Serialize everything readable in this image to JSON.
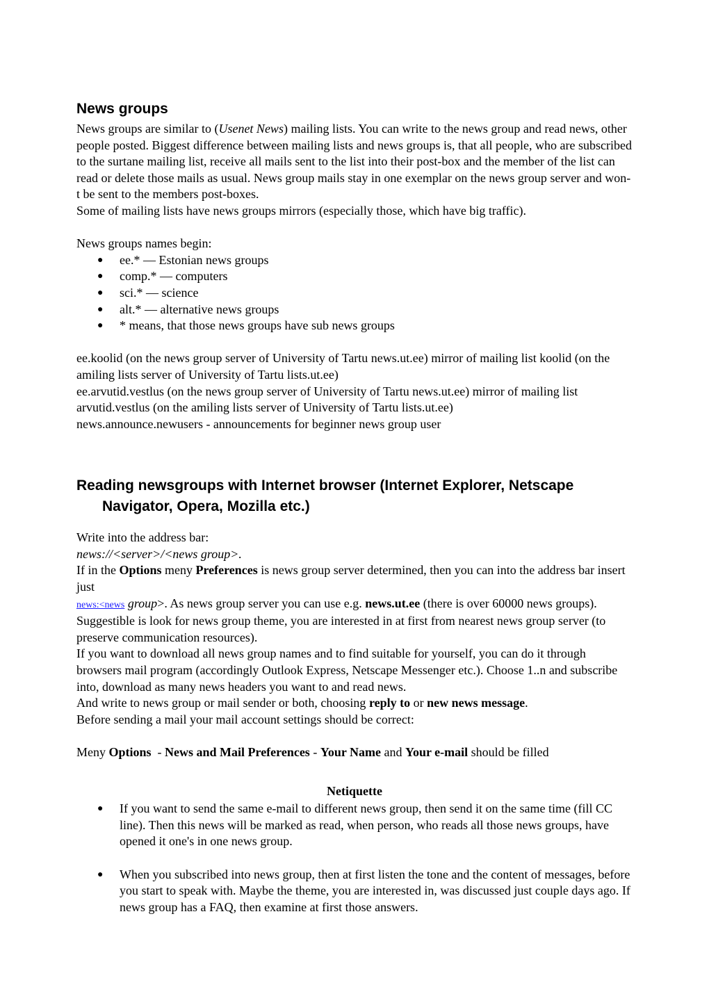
{
  "section1": {
    "title": "News groups",
    "intro": {
      "t1": "News groups are similar to  (",
      "usenet": "Usenet News",
      "t2": ") mailing lists. You can write to the news group and read news, other people posted. Biggest difference between mailing lists and news groups is, that all people, who are subscribed to the surtane mailing list, receive all mails sent to the list into their post-box and the member of the list can read or delete those mails as usual. News group mails stay in one exemplar on the news group server and won-t be sent to the members post-boxes."
    },
    "mirrors": "Some of mailing lists have news groups mirrors (especially those, which have big traffic).",
    "names_intro": "News groups names begin:",
    "names": [
      "ee.* — Estonian news groups",
      "comp.* — computers",
      "sci.* — science",
      "alt.* — alternative news groups",
      "* means, that those news groups have sub news groups"
    ],
    "examples": [
      "ee.koolid (on the news group server of University of Tartu news.ut.ee) mirror of mailing list koolid (on the amiling lists server of University of Tartu lists.ut.ee)",
      "ee.arvutid.vestlus (on the news group server of University of Tartu news.ut.ee) mirror of mailing list arvutid.vestlus (on the amiling lists server of University of Tartu lists.ut.ee)",
      "news.announce.newusers - announcements for beginner news group user"
    ]
  },
  "section2": {
    "title": "Reading newsgroups with Internet browser (Internet Explorer, Netscape Navigator, Opera, Mozilla etc.)",
    "write_into": "Write into the address bar:",
    "url_pattern": "news://<server>/<news group>.",
    "options": {
      "t1": " If in the ",
      "b1": "Options",
      "t2": " meny ",
      "b2": "Preferences",
      "t3": " is news group server determined, then you can into the address bar insert just"
    },
    "link_text": "news:<news",
    "after_link": {
      "i1": " group",
      "t1": ">. As news group server you can use e.g. ",
      "b1": "news.ut.ee",
      "t2": " (there is over 60000 news groups). Suggestible is look for news group theme, you are interested in at first from nearest news group server (to preserve communication resources)."
    },
    "download": "If you want to download all news group names and to find suitable for yourself, you can do it through browsers mail program (accordingly Outlook Express, Netscape Messenger etc.). Choose 1..n and subscribe into, download as many news headers you want to and read news.",
    "write_to": {
      "t1": "And write to news group or mail sender or both, choosing ",
      "b1": "reply to",
      "t2": " or ",
      "b2": "new news message",
      "t3": "."
    },
    "before_sending": "Before sending a mail your mail account settings should be correct:",
    "meny": {
      "t1": "Meny ",
      "b1": "Options",
      "t2": "  - ",
      "b2": "News and Mail Preferences",
      "t3": " - ",
      "b3": "Your Name",
      "t4": " and ",
      "b4": "Your e-mail",
      "t5": " should be filled"
    }
  },
  "netiquette": {
    "title": "Netiquette",
    "items": [
      "If you want to send the same e-mail to different news group, then send it on the same time (fill CC line). Then this news will be marked as read, when person, who reads all those news groups, have opened it one's in one news group.",
      "When you subscribed into news group, then at first listen the tone and the content of messages, before you start to speak with. Maybe the theme, you are interested in, was discussed just couple days ago. If news group has a FAQ, then examine at first those answers."
    ]
  },
  "bullet_glyph": "●",
  "colors": {
    "link": "#1a1aff",
    "text": "#000000"
  }
}
